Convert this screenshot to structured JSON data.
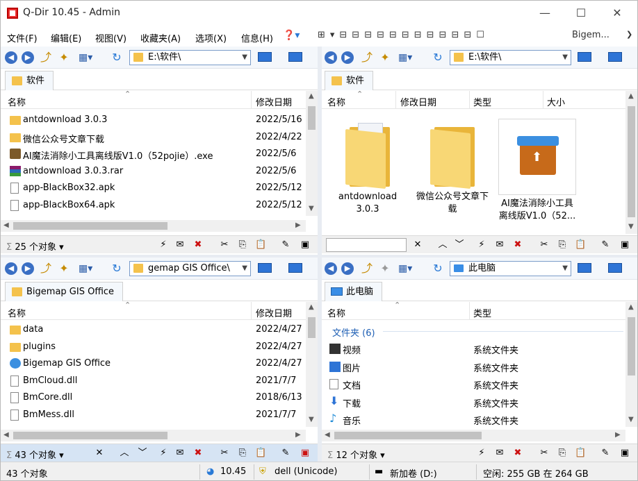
{
  "window": {
    "title": "Q-Dir 10.45 - Admin",
    "min": "—",
    "max": "☐",
    "close": "✕"
  },
  "menu": [
    "文件(F)",
    "编辑(E)",
    "视图(V)",
    "收藏夹(A)",
    "选项(X)",
    "信息(H)"
  ],
  "toolbar": {
    "bigemap": "Bigem...",
    "more": "❯"
  },
  "colors": {
    "accent": "#3a6fc4",
    "folder": "#f4c24c",
    "danger": "#cc1111",
    "status": "#f0f0f0"
  },
  "panes": {
    "tl": {
      "path": "E:\\软件\\",
      "tab": "软件",
      "headers": [
        "名称",
        "修改日期"
      ],
      "rows": [
        {
          "icon": "folder",
          "name": "antdownload 3.0.3",
          "date": "2022/5/16"
        },
        {
          "icon": "folder",
          "name": "微信公众号文章下载",
          "date": "2022/4/22"
        },
        {
          "icon": "exe",
          "name": "AI魔法消除小工具离线版V1.0（52pojie）.exe",
          "date": "2022/5/6"
        },
        {
          "icon": "rar",
          "name": "antdownload 3.0.3.rar",
          "date": "2022/5/6"
        },
        {
          "icon": "file",
          "name": "app-BlackBox32.apk",
          "date": "2022/5/12"
        },
        {
          "icon": "file",
          "name": "app-BlackBox64.apk",
          "date": "2022/5/12"
        }
      ],
      "status": "25 个对象"
    },
    "tr": {
      "path": "E:\\软件\\",
      "tab": "软件",
      "headers": [
        "名称",
        "修改日期",
        "类型",
        "大小"
      ],
      "items": [
        {
          "line1": "antdownload",
          "line2": "3.0.3"
        },
        {
          "line1": "微信公众号文章下",
          "line2": "载"
        },
        {
          "line1": "AI魔法消除小工具",
          "line2": "离线版V1.0（52..."
        }
      ]
    },
    "bl": {
      "path": "gemap GIS Office\\",
      "tab": "Bigemap GIS Office",
      "headers": [
        "名称",
        "修改日期"
      ],
      "rows": [
        {
          "icon": "folder",
          "name": "data",
          "date": "2022/4/27"
        },
        {
          "icon": "folder",
          "name": "plugins",
          "date": "2022/4/27"
        },
        {
          "icon": "app",
          "name": "Bigemap GIS Office",
          "date": "2022/4/27"
        },
        {
          "icon": "dll",
          "name": "BmCloud.dll",
          "date": "2021/7/7"
        },
        {
          "icon": "dll",
          "name": "BmCore.dll",
          "date": "2018/6/13"
        },
        {
          "icon": "dll",
          "name": "BmMess.dll",
          "date": "2021/7/7"
        }
      ],
      "status": "43 个对象"
    },
    "br": {
      "path": "此电脑",
      "tab": "此电脑",
      "headers": [
        "名称",
        "类型"
      ],
      "group": "文件夹 (6)",
      "rows": [
        {
          "name": "视频",
          "type": "系统文件夹",
          "color": "#333"
        },
        {
          "name": "图片",
          "type": "系统文件夹",
          "color": "#2e74d6"
        },
        {
          "name": "文档",
          "type": "系统文件夹",
          "color": "#888"
        },
        {
          "name": "下载",
          "type": "系统文件夹",
          "color": "#2e74d6"
        },
        {
          "name": "音乐",
          "type": "系统文件夹",
          "color": "#1e8ad6"
        }
      ],
      "status": "12 个对象"
    }
  },
  "bottom": {
    "count": "43 个对象",
    "version": "10.45",
    "user": "dell (Unicode)",
    "drive": "新加卷 (D:)",
    "space": "空闲: 255 GB 在 264 GB"
  }
}
